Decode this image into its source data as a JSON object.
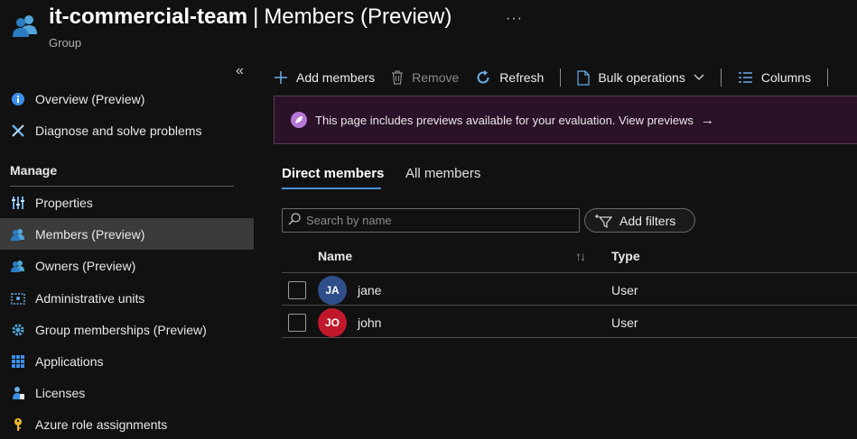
{
  "header": {
    "title_bold": "it-commercial-team",
    "title_sep": "|",
    "title_rest": "Members (Preview)",
    "subtitle": "Group",
    "more": "···"
  },
  "sidebar": {
    "collapse": "«",
    "items": [
      {
        "label": "Overview (Preview)",
        "icon": "info-icon"
      },
      {
        "label": "Diagnose and solve problems",
        "icon": "wrench-icon"
      }
    ],
    "section_title": "Manage",
    "manage_items": [
      {
        "label": "Properties",
        "icon": "properties-icon"
      },
      {
        "label": "Members (Preview)",
        "icon": "members-icon",
        "active": true
      },
      {
        "label": "Owners (Preview)",
        "icon": "owners-icon"
      },
      {
        "label": "Administrative units",
        "icon": "admin-units-icon"
      },
      {
        "label": "Group memberships (Preview)",
        "icon": "gear-icon"
      },
      {
        "label": "Applications",
        "icon": "grid-icon"
      },
      {
        "label": "Licenses",
        "icon": "license-icon"
      },
      {
        "label": "Azure role assignments",
        "icon": "key-icon"
      }
    ]
  },
  "toolbar": {
    "add_members": "Add members",
    "remove": "Remove",
    "refresh": "Refresh",
    "bulk_operations": "Bulk operations",
    "columns": "Columns"
  },
  "banner": {
    "text": "This page includes previews available for your evaluation. View previews",
    "arrow": "→"
  },
  "tabs": {
    "direct": "Direct members",
    "all": "All members"
  },
  "search": {
    "placeholder": "Search by name"
  },
  "filters": {
    "label": "Add filters"
  },
  "table": {
    "col_name": "Name",
    "col_type": "Type",
    "sort": "↑↓",
    "rows": [
      {
        "initials": "JA",
        "name": "jane",
        "type": "User",
        "avatar_color": "#2f4f8a"
      },
      {
        "initials": "JO",
        "name": "john",
        "type": "User",
        "avatar_color": "#c0182a"
      }
    ]
  },
  "colors": {
    "accent": "#4a90d9",
    "banner_bg": "#2a1229",
    "active_nav": "#3b3b3b"
  }
}
